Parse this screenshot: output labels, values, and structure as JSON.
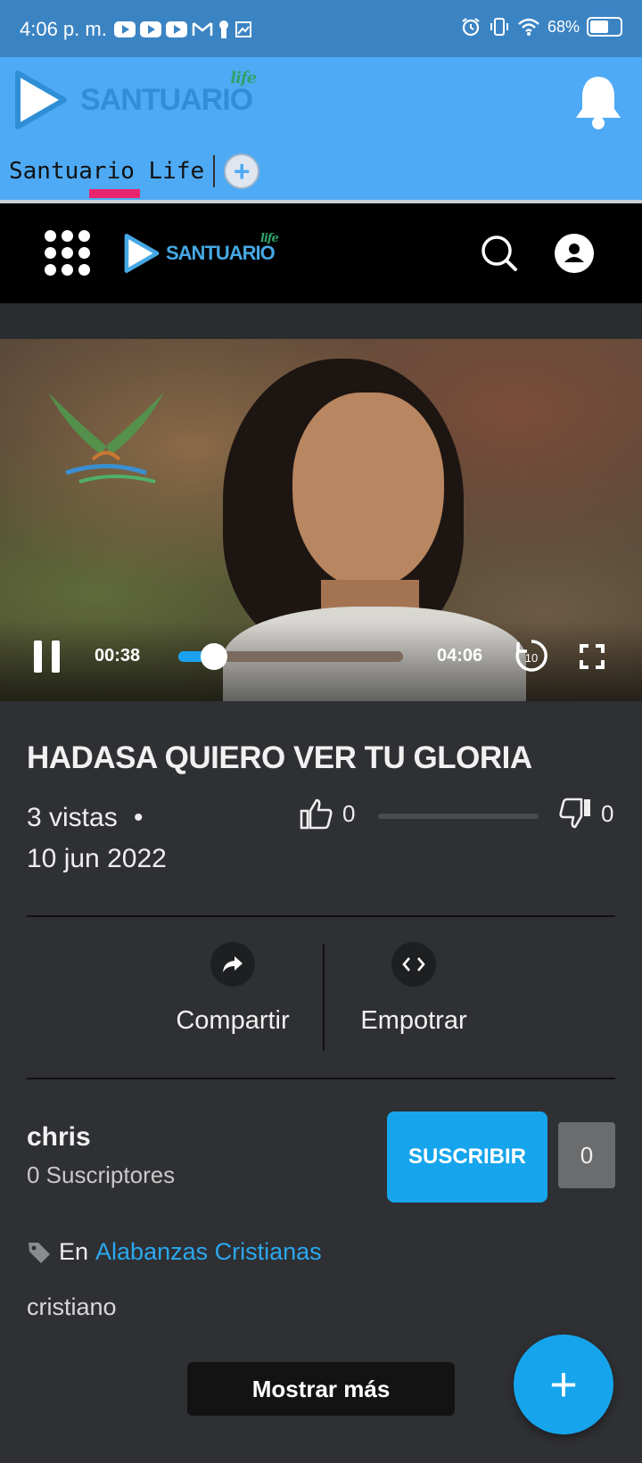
{
  "status_bar": {
    "time": "4:06 p. m.",
    "battery": "68%",
    "battery_level": 0.68
  },
  "app_header": {
    "brand": "SANTUARIO",
    "brand_small": "life",
    "tab_label": "Santuario Life",
    "add_tab_symbol": "+"
  },
  "site_nav": {
    "brand": "SANTUARIO",
    "brand_small": "life"
  },
  "player": {
    "current_time": "00:38",
    "total_time": "04:06",
    "progress": 0.16,
    "skip_seconds": "10"
  },
  "video": {
    "title": "HADASA QUIERO VER TU GLORIA",
    "views": "3 vistas",
    "dot": "•",
    "date": "10 jun 2022",
    "likes": "0",
    "dislikes": "0"
  },
  "actions": {
    "share_label": "Compartir",
    "embed_label": "Empotrar"
  },
  "channel": {
    "name": "chris",
    "subscribers": "0 Suscriptores",
    "subscribe_label": "SUSCRIBIR",
    "subscribe_count": "0"
  },
  "category": {
    "prefix": "En",
    "name": "Alabanzas Cristianas"
  },
  "tags": "cristiano",
  "show_more_label": "Mostrar más",
  "fab_symbol": "+",
  "colors": {
    "status_bar": "#3b84c4",
    "app_header": "#4eaaf4",
    "accent": "#16a5ec",
    "tab_indicator": "#e8256d",
    "content_bg": "#2f3033"
  }
}
